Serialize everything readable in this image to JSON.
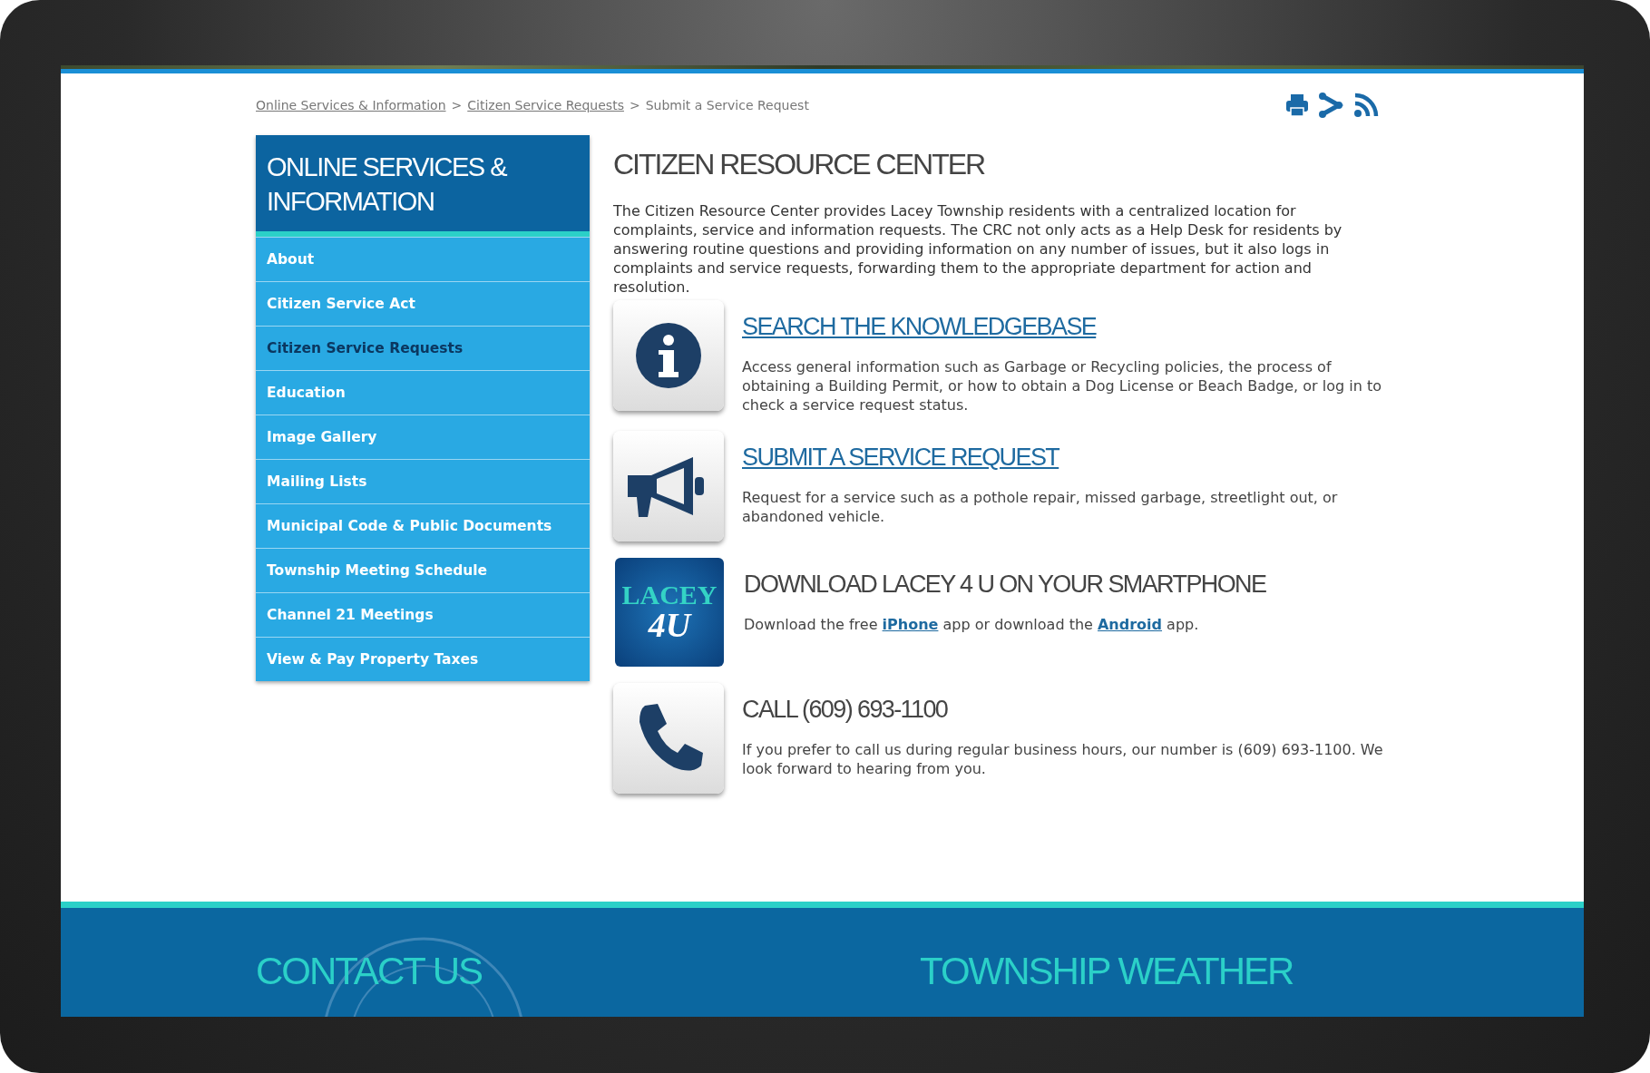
{
  "breadcrumb": [
    {
      "label": "Online Services & Information",
      "link": true
    },
    {
      "label": "Citizen Service Requests",
      "link": true
    },
    {
      "label": "Submit a Service Request",
      "link": false
    }
  ],
  "breadcrumb_separator": ">",
  "sidebar": {
    "title": "ONLINE SERVICES & INFORMATION",
    "items": [
      {
        "label": "About",
        "selected": false
      },
      {
        "label": "Citizen Service Act",
        "selected": false
      },
      {
        "label": "Citizen Service Requests",
        "selected": true
      },
      {
        "label": "Education",
        "selected": false
      },
      {
        "label": "Image Gallery",
        "selected": false
      },
      {
        "label": "Mailing Lists",
        "selected": false
      },
      {
        "label": "Municipal Code & Public Documents",
        "selected": false
      },
      {
        "label": "Township Meeting Schedule",
        "selected": false
      },
      {
        "label": "Channel 21 Meetings",
        "selected": false
      },
      {
        "label": "View & Pay Property Taxes",
        "selected": false
      }
    ]
  },
  "main": {
    "title": "CITIZEN RESOURCE CENTER",
    "intro": "The Citizen Resource Center provides Lacey Township residents with a centralized location for complaints, service and information requests. The CRC not only acts as a Help Desk for residents by answering routine questions and providing information on any number of issues, but it also logs in complaints and service requests, forwarding them to the appropriate department for action and resolution.",
    "sections": [
      {
        "kind": "info",
        "title": "SEARCH THE KNOWLEDGEBASE",
        "title_link": true,
        "body": [
          {
            "text": "Access general information such as Garbage or Recycling policies, the process of obtaining a Building Permit, or how to obtain a Dog License or Beach Badge, or log in to check a service request status.",
            "link": false
          }
        ]
      },
      {
        "kind": "megaphone",
        "title": "SUBMIT A SERVICE REQUEST",
        "title_link": true,
        "body": [
          {
            "text": "Request for a service such as a pothole repair, missed garbage, streetlight out, or abandoned vehicle.",
            "link": false
          }
        ]
      },
      {
        "kind": "app-logo",
        "logo_text": [
          "LACEY",
          "4U"
        ],
        "title": "DOWNLOAD LACEY 4 U ON YOUR SMARTPHONE",
        "title_link": false,
        "body": [
          {
            "text": "Download the free ",
            "link": false
          },
          {
            "text": "iPhone",
            "link": true
          },
          {
            "text": " app or download the ",
            "link": false
          },
          {
            "text": "Android",
            "link": true
          },
          {
            "text": " app.",
            "link": false
          }
        ]
      },
      {
        "kind": "phone",
        "title": "CALL (609) 693-1100",
        "title_link": false,
        "body": [
          {
            "text": "If you prefer to call us during regular business hours, our number is (609) 693-1100. We look forward to hearing from you.",
            "link": false
          }
        ]
      }
    ]
  },
  "footer": {
    "headings": [
      "CONTACT US",
      "TOWNSHIP WEATHER"
    ]
  }
}
